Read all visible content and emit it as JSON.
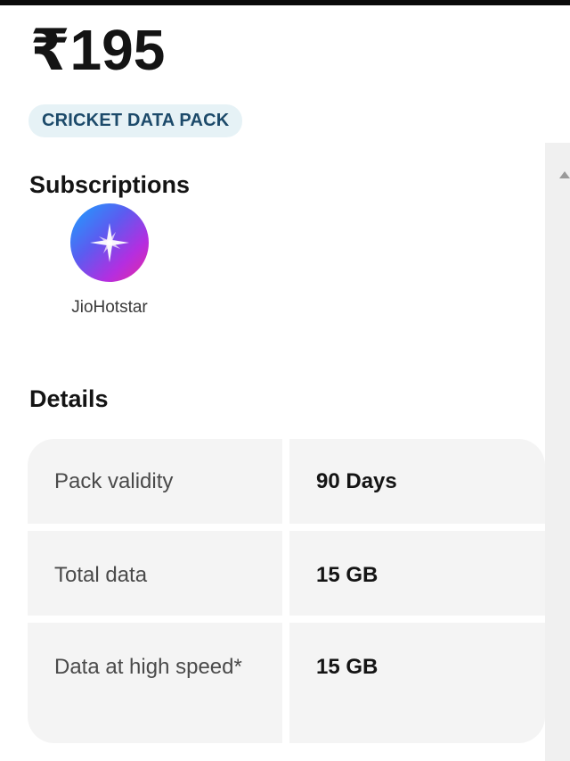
{
  "pack": {
    "price": "₹195",
    "badge": "CRICKET DATA PACK"
  },
  "subscriptions": {
    "title": "Subscriptions",
    "items": [
      {
        "label": "JioHotstar",
        "icon": "jiohotstar-logo-icon"
      }
    ]
  },
  "details": {
    "title": "Details",
    "rows": [
      {
        "label": "Pack validity",
        "value": "90 Days"
      },
      {
        "label": "Total data",
        "value": "15 GB"
      },
      {
        "label": "Data at high speed*",
        "value": "15 GB"
      }
    ]
  },
  "colors": {
    "badge_bg": "#e6f2f6",
    "badge_text": "#1c4a6a",
    "cell_bg": "#f4f4f4"
  }
}
